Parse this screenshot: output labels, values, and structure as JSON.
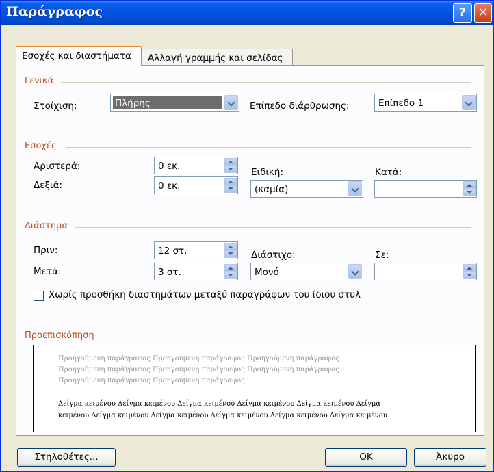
{
  "window": {
    "title": "Παράγραφος",
    "help_glyph": "?",
    "close_glyph": "✕"
  },
  "tabs": [
    {
      "label": "Εσοχές και διαστήματα",
      "active": true
    },
    {
      "label": "Αλλαγή γραμμής και σελίδας",
      "active": false
    }
  ],
  "general": {
    "group_label": "Γενικά",
    "alignment_label": "Στοίχιση:",
    "alignment_value": "Πλήρης",
    "outline_label": "Επίπεδο διάρθρωσης:",
    "outline_value": "Επίπεδο 1"
  },
  "indentation": {
    "group_label": "Εσοχές",
    "left_label": "Αριστερά:",
    "left_value": "0 εκ.",
    "right_label": "Δεξιά:",
    "right_value": "0 εκ.",
    "special_label": "Ειδική:",
    "special_value": "(καμία)",
    "by_label": "Κατά:",
    "by_value": ""
  },
  "spacing": {
    "group_label": "Διάστημα",
    "before_label": "Πριν:",
    "before_value": "12 στ.",
    "after_label": "Μετά:",
    "after_value": "3 στ.",
    "line_spacing_label": "Διάστιχο:",
    "line_spacing_value": "Μονό",
    "at_label": "Σε:",
    "at_value": "",
    "no_space_checkbox_label": "Χωρίς προσθήκη διαστημάτων μεταξύ παραγράφων του ίδιου στυλ",
    "no_space_checked": false
  },
  "preview": {
    "group_label": "Προεπισκόπηση",
    "previous_lines": [
      "Προηγούμενη παράγραφος Προηγούμενη παράγραφος Προηγούμενη παράγραφος",
      "Προηγούμενη παράγραφος Προηγούμενη παράγραφος Προηγούμενη παράγραφος",
      "Προηγούμενη παράγραφος Προηγούμενη παράγραφος"
    ],
    "sample_lines": [
      "Δείγμα κειμένου Δείγμα κειμένου Δείγμα κειμένου Δείγμα κειμένου Δείγμα κειμένου Δείγμα",
      "κειμένου Δείγμα κειμένου Δείγμα κειμένου Δείγμα κειμένου Δείγμα κειμένου Δείγμα κειμένου"
    ]
  },
  "buttons": {
    "tabs_label": "Στηλοθέτες...",
    "ok_label": "ΟΚ",
    "cancel_label": "Άκυρο"
  },
  "colors": {
    "title_bar": "#0054e3",
    "group_label": "#c0501b",
    "dialog_bg": "#ece9d8"
  }
}
